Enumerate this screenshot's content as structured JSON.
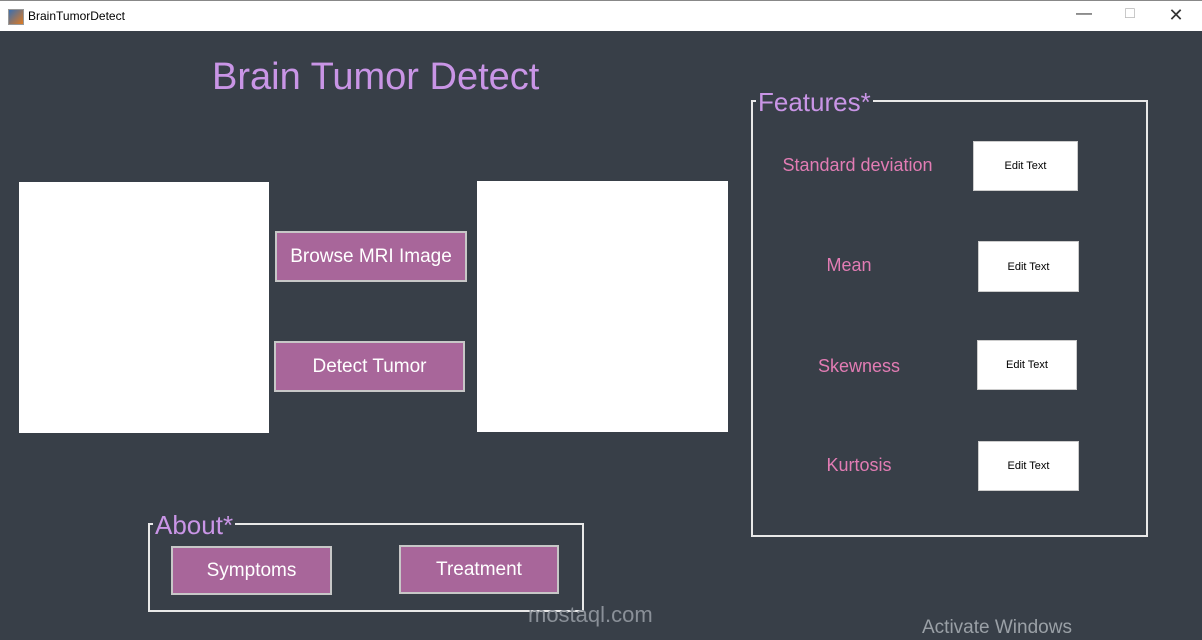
{
  "window": {
    "title": "BrainTumorDetect"
  },
  "app": {
    "title": "Brain Tumor Detect"
  },
  "buttons": {
    "browse": "Browse MRI Image",
    "detect": "Detect Tumor",
    "symptoms": "Symptoms",
    "treatment": "Treatment"
  },
  "about": {
    "legend": "About*"
  },
  "features": {
    "legend": "Features*",
    "items": [
      {
        "label": "Standard deviation",
        "value": "Edit Text"
      },
      {
        "label": "Mean",
        "value": "Edit Text"
      },
      {
        "label": "Skewness",
        "value": "Edit Text"
      },
      {
        "label": "Kurtosis",
        "value": "Edit Text"
      }
    ]
  },
  "watermark": {
    "activate": "Activate Windows",
    "site": "mostaql.com"
  }
}
